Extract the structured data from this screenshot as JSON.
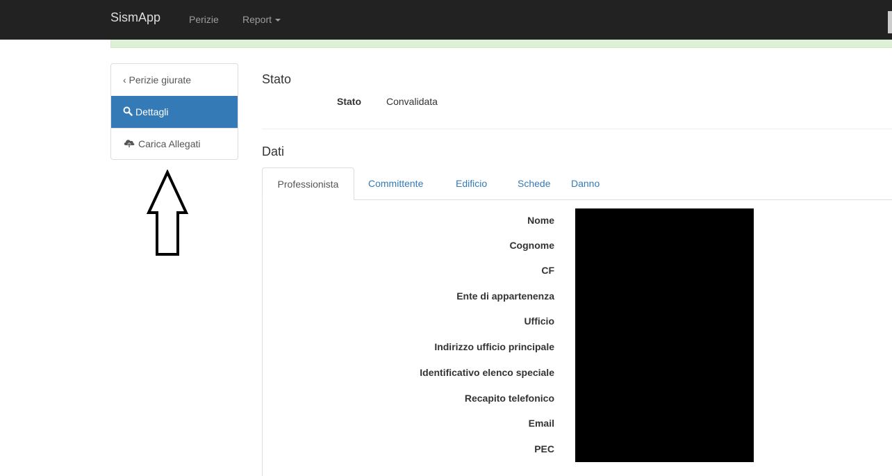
{
  "navbar": {
    "brand": "SismApp",
    "links": [
      {
        "label": "Perizie"
      },
      {
        "label": "Report"
      }
    ]
  },
  "sidebar": {
    "items": [
      {
        "label": "‹ Perizie giurate"
      },
      {
        "label": "Dettagli",
        "icon": "search-icon"
      },
      {
        "label": "Carica Allegati",
        "icon": "cloud-upload-icon"
      }
    ]
  },
  "stato": {
    "title": "Stato",
    "label": "Stato",
    "value": "Convalidata"
  },
  "dati": {
    "title": "Dati",
    "tabs": [
      "Professionista",
      "Committente",
      "Edificio",
      "Schede",
      "Danno"
    ],
    "active_tab": "Professionista",
    "fields": [
      "Nome",
      "Cognome",
      "CF",
      "Ente di appartenenza",
      "Ufficio",
      "Indirizzo ufficio principale",
      "Identificativo elenco speciale",
      "Recapito telefonico",
      "Email",
      "PEC"
    ]
  },
  "colors": {
    "navbar": "#222222",
    "active": "#337ab7",
    "link": "#337ab7",
    "success_strip": "#dff0d8"
  }
}
